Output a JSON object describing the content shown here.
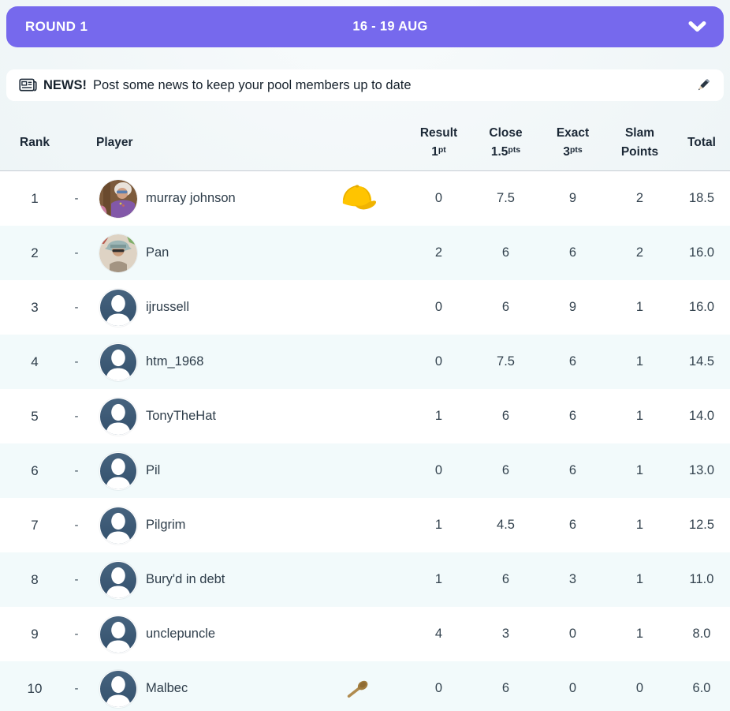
{
  "round_bar": {
    "title": "ROUND 1",
    "dates": "16 - 19 AUG",
    "chevron_icon": "chevron-down-icon"
  },
  "news_bar": {
    "icon": "newspaper-icon",
    "label": "NEWS!",
    "message": "Post some news to keep your pool members up to date",
    "edit_icon": "pencil-icon"
  },
  "table": {
    "rank_header": "Rank",
    "player_header": "Player",
    "stat_columns": [
      {
        "line1": "Result",
        "line2": "1",
        "sup": "pt"
      },
      {
        "line1": "Close",
        "line2": "1.5",
        "sup": "pts"
      },
      {
        "line1": "Exact",
        "line2": "3",
        "sup": "pts"
      },
      {
        "line1": "Slam",
        "line2": "Points",
        "sup": ""
      },
      {
        "line1": "Total",
        "line2": "",
        "sup": ""
      }
    ],
    "rows": [
      {
        "rank": "1",
        "movement": "-",
        "player": "murray johnson",
        "avatar": "photo-murray",
        "badge": "cap-icon",
        "result": "0",
        "close": "7.5",
        "exact": "9",
        "slam": "2",
        "total": "18.5"
      },
      {
        "rank": "2",
        "movement": "-",
        "player": "Pan",
        "avatar": "photo-pan",
        "badge": "",
        "result": "2",
        "close": "6",
        "exact": "6",
        "slam": "2",
        "total": "16.0"
      },
      {
        "rank": "3",
        "movement": "-",
        "player": "ijrussell",
        "avatar": "default",
        "badge": "",
        "result": "0",
        "close": "6",
        "exact": "9",
        "slam": "1",
        "total": "16.0"
      },
      {
        "rank": "4",
        "movement": "-",
        "player": "htm_1968",
        "avatar": "default",
        "badge": "",
        "result": "0",
        "close": "7.5",
        "exact": "6",
        "slam": "1",
        "total": "14.5"
      },
      {
        "rank": "5",
        "movement": "-",
        "player": "TonyTheHat",
        "avatar": "default",
        "badge": "",
        "result": "1",
        "close": "6",
        "exact": "6",
        "slam": "1",
        "total": "14.0"
      },
      {
        "rank": "6",
        "movement": "-",
        "player": "Pil",
        "avatar": "default",
        "badge": "",
        "result": "0",
        "close": "6",
        "exact": "6",
        "slam": "1",
        "total": "13.0"
      },
      {
        "rank": "7",
        "movement": "-",
        "player": "Pilgrim",
        "avatar": "default",
        "badge": "",
        "result": "1",
        "close": "4.5",
        "exact": "6",
        "slam": "1",
        "total": "12.5"
      },
      {
        "rank": "8",
        "movement": "-",
        "player": "Bury'd in debt",
        "avatar": "default",
        "badge": "",
        "result": "1",
        "close": "6",
        "exact": "3",
        "slam": "1",
        "total": "11.0"
      },
      {
        "rank": "9",
        "movement": "-",
        "player": "unclepuncle",
        "avatar": "default",
        "badge": "",
        "result": "4",
        "close": "3",
        "exact": "0",
        "slam": "1",
        "total": "8.0"
      },
      {
        "rank": "10",
        "movement": "-",
        "player": "Malbec",
        "avatar": "default",
        "badge": "spoon-icon",
        "result": "0",
        "close": "6",
        "exact": "0",
        "slam": "0",
        "total": "6.0"
      }
    ]
  },
  "colors": {
    "accent_purple": "#7669ed",
    "row_alt": "#f2fafb",
    "header_text": "#1b2836",
    "avatar_silhouette": "#3d5a78",
    "cap_yellow": "#ffc400",
    "spoon_brown": "#a9824a"
  }
}
